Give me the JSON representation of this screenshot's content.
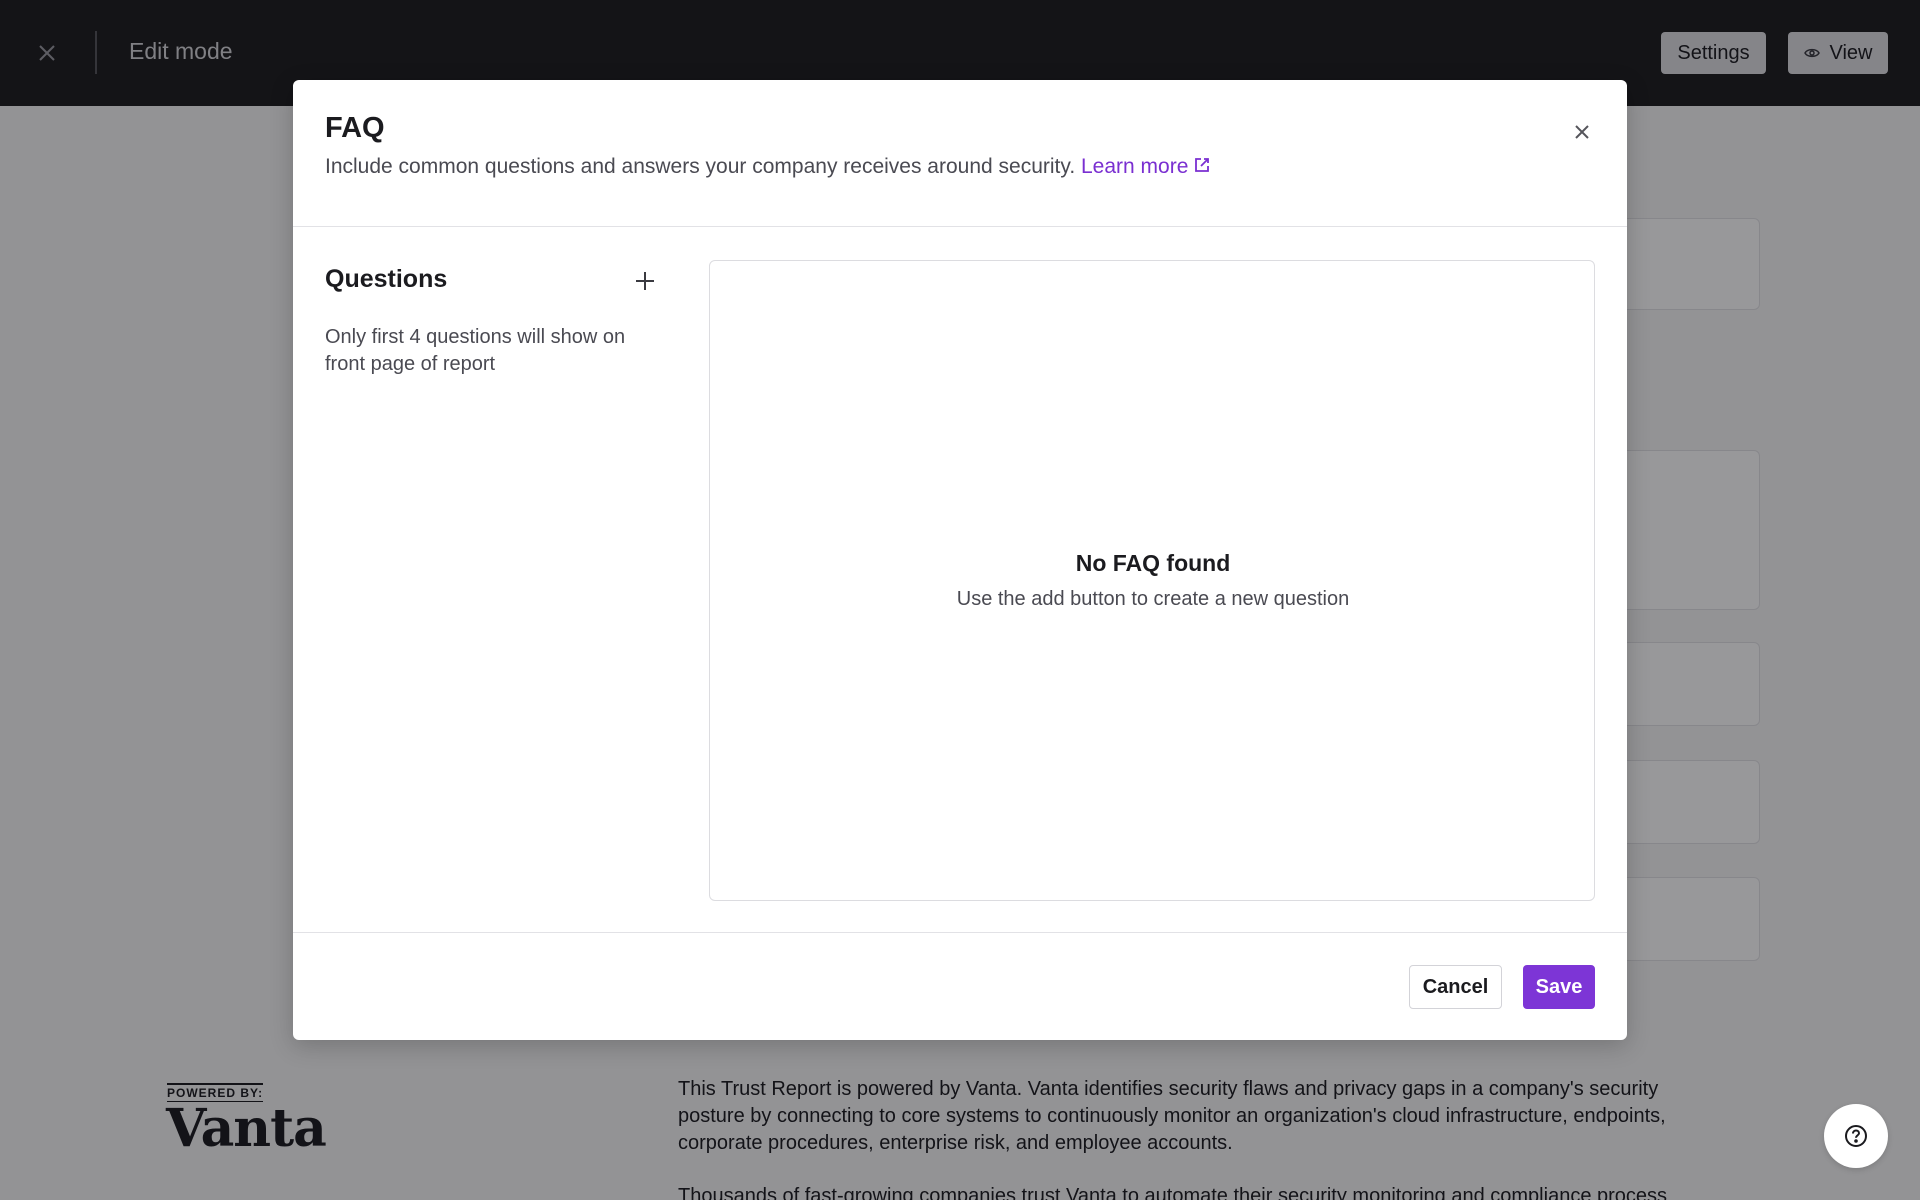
{
  "header": {
    "title": "Edit mode",
    "settings_label": "Settings",
    "view_label": "View"
  },
  "footer": {
    "powered_by": "POWERED BY:",
    "logo_text": "Vanta",
    "about_paragraph": "This Trust Report is powered by Vanta. Vanta identifies security flaws and privacy gaps in a company's security posture by connecting to core systems to continuously monitor an organization's cloud infrastructure, endpoints, corporate procedures, enterprise risk, and employee accounts.",
    "about_paragraph_2": "Thousands of fast-growing companies trust Vanta to automate their security monitoring and compliance process"
  },
  "modal": {
    "title": "FAQ",
    "description": "Include common questions and answers your company receives around security.",
    "learn_more": "Learn more",
    "questions_heading": "Questions",
    "questions_hint": "Only first 4 questions will show on front page of report",
    "empty_title": "No FAQ found",
    "empty_subtitle": "Use the add button to create a new question",
    "cancel_label": "Cancel",
    "save_label": "Save"
  },
  "icons": {
    "close": "close-icon",
    "eye": "eye-icon",
    "external_link": "external-link-icon",
    "plus": "plus-icon",
    "help": "help-icon"
  },
  "colors": {
    "accent": "#7d35d6",
    "link": "#7a2fd1",
    "topbar": "#1c1c1e"
  }
}
